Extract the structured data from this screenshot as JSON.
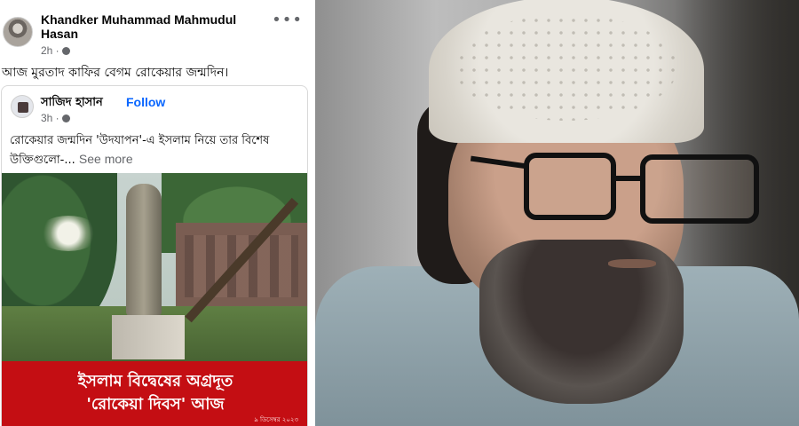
{
  "post": {
    "author": "Khandker Muhammad Mahmudul Hasan",
    "time": "2h ·",
    "text": "আজ  মুরতাদ কাফির বেগম রোকেয়ার জন্মদিন।"
  },
  "shared_post": {
    "author": "সাজিদ হাসান",
    "follow_label": "Follow",
    "time": "3h ·",
    "text": "রোকেয়ার জন্মদিন 'উদযাপন'-এ ইসলাম নিয়ে তার বিশেষ উক্তিগুলো-...",
    "see_more_label": "See more"
  },
  "banner": {
    "line1": "ইসলাম বিদ্বেষের অগ্রদূত",
    "line2": "'রোকেয়া দিবস' আজ",
    "date": "৯ ডিসেম্বর ২০২৩"
  },
  "colors": {
    "link_blue": "#0866ff",
    "banner_red": "#c40e13"
  },
  "icons": {
    "more": "more-horizontal-icon",
    "privacy": "globe-icon"
  }
}
